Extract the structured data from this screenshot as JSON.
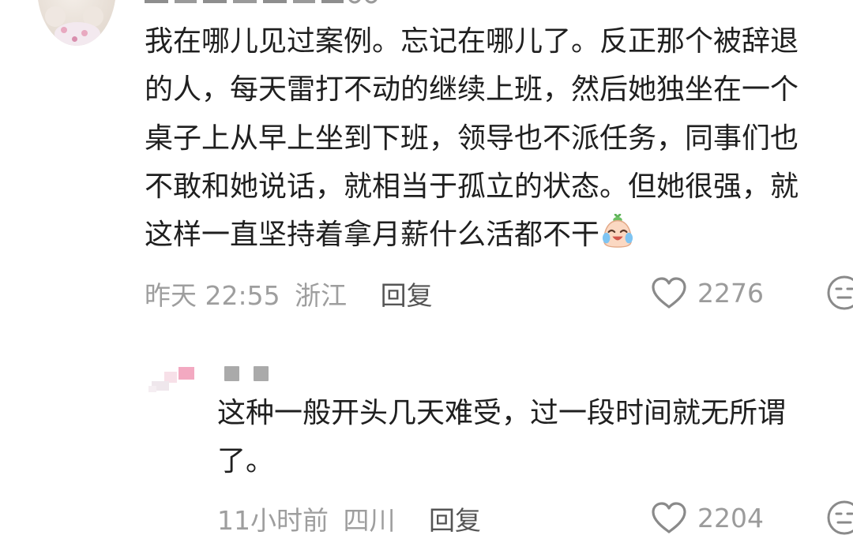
{
  "top_comment": {
    "lines": [
      "我在哪儿见过案例。忘记在哪儿了。反正那个被辞退",
      "的人，每天雷打不动的继续上班，然后她独坐在一个",
      "桌子上从早上坐到下班，领导也不派任务，同事们也",
      "不敢和她说话，就相当于孤立的状态。但她很强，就",
      "这样一直坚持着拿月薪什么活都不干"
    ],
    "emoji": "crying-laughing-emoji",
    "time": "昨天 22:55",
    "location": "浙江",
    "reply_label": "回复",
    "likes": "2276"
  },
  "reply_comment": {
    "lines": [
      "这种一般开头几天难受，过一段时间就无所谓",
      "了。"
    ],
    "time": "11小时前",
    "location": "四川",
    "reply_label": "回复",
    "likes": "2204"
  },
  "colors": {
    "text": "#1f1f1f",
    "meta": "#9e9e9e",
    "reply": "#555555",
    "icon": "#8a8a8a"
  }
}
